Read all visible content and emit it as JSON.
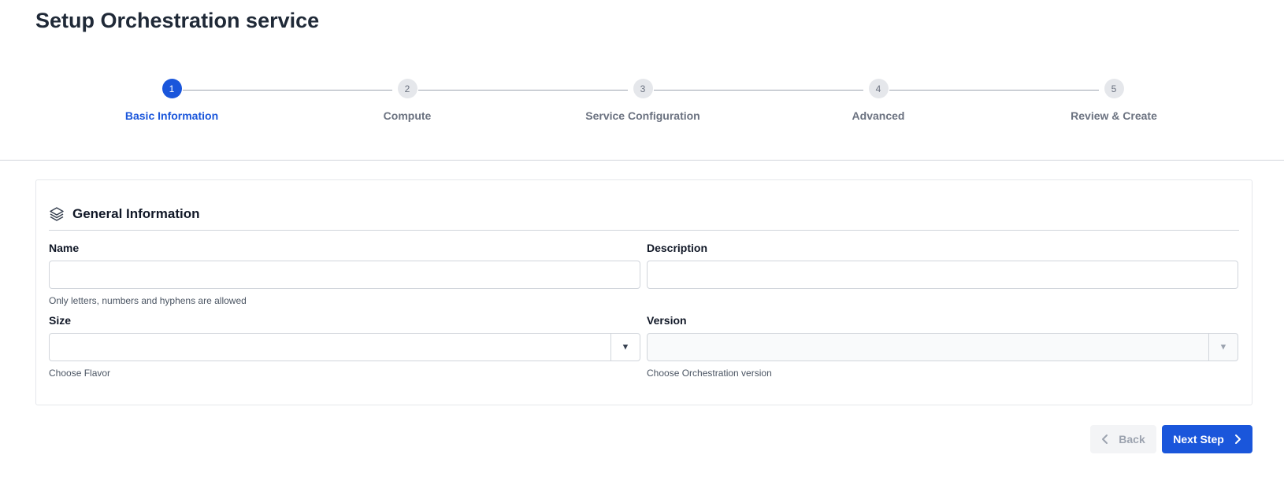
{
  "page": {
    "title": "Setup Orchestration service"
  },
  "stepper": {
    "steps": [
      {
        "number": "1",
        "label": "Basic Information",
        "active": true
      },
      {
        "number": "2",
        "label": "Compute",
        "active": false
      },
      {
        "number": "3",
        "label": "Service Configuration",
        "active": false
      },
      {
        "number": "4",
        "label": "Advanced",
        "active": false
      },
      {
        "number": "5",
        "label": "Review & Create",
        "active": false
      }
    ]
  },
  "card": {
    "title": "General Information",
    "icon": "layers-icon",
    "fields": {
      "name": {
        "label": "Name",
        "value": "",
        "help": "Only letters, numbers and hyphens are allowed"
      },
      "description": {
        "label": "Description",
        "value": ""
      },
      "size": {
        "label": "Size",
        "value": "",
        "help": "Choose Flavor"
      },
      "version": {
        "label": "Version",
        "value": "",
        "help": "Choose Orchestration version",
        "disabled": true
      }
    }
  },
  "footer": {
    "back_label": "Back",
    "next_label": "Next Step"
  },
  "colors": {
    "primary": "#1a56db",
    "muted": "#6b7280",
    "border": "#d1d5db"
  }
}
